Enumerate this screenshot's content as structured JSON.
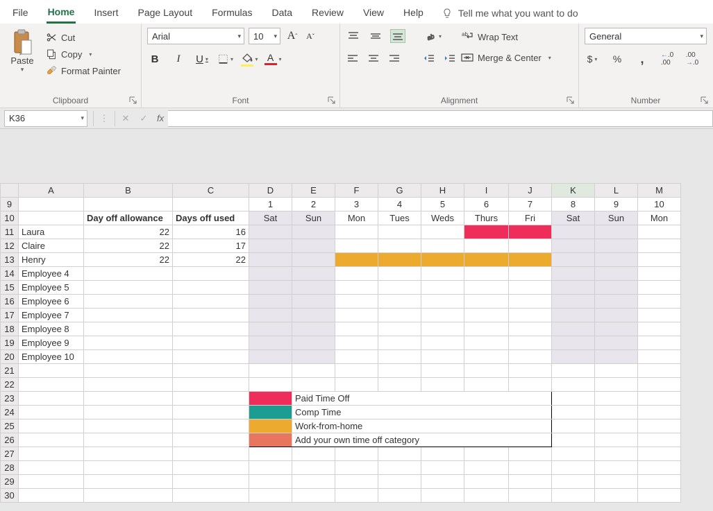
{
  "menu": {
    "items": [
      "File",
      "Home",
      "Insert",
      "Page Layout",
      "Formulas",
      "Data",
      "Review",
      "View",
      "Help"
    ],
    "active": "Home",
    "tellme": "Tell me what you want to do"
  },
  "ribbon": {
    "clipboard": {
      "paste": "Paste",
      "cut": "Cut",
      "copy": "Copy",
      "format_painter": "Format Painter",
      "label": "Clipboard"
    },
    "font": {
      "name": "Arial",
      "size": "10",
      "label": "Font"
    },
    "alignment": {
      "wrap": "Wrap Text",
      "merge": "Merge & Center",
      "label": "Alignment"
    },
    "number": {
      "format": "General",
      "label": "Number"
    }
  },
  "formula_bar": {
    "name_box": "K36",
    "fx": "fx"
  },
  "columns": [
    "A",
    "B",
    "C",
    "D",
    "E",
    "F",
    "G",
    "H",
    "I",
    "J",
    "K",
    "L",
    "M"
  ],
  "rows_visible": [
    9,
    10,
    11,
    12,
    13,
    14,
    15,
    16,
    17,
    18,
    19,
    20,
    21,
    22,
    23,
    24,
    25,
    26,
    27,
    28,
    29,
    30
  ],
  "header_row": {
    "day_nums": [
      "1",
      "2",
      "3",
      "4",
      "5",
      "6",
      "7",
      "8",
      "9",
      "10"
    ],
    "col_b": "Day off allowance",
    "col_c": "Days off used",
    "day_names": [
      "Sat",
      "Sun",
      "Mon",
      "Tues",
      "Weds",
      "Thurs",
      "Fri",
      "Sat",
      "Sun",
      "Mon"
    ]
  },
  "employees": [
    {
      "name": "Laura",
      "allowance": "22",
      "used": "16"
    },
    {
      "name": "Claire",
      "allowance": "22",
      "used": "17"
    },
    {
      "name": "Henry",
      "allowance": "22",
      "used": "22"
    },
    {
      "name": "Employee 4",
      "allowance": "",
      "used": ""
    },
    {
      "name": "Employee 5",
      "allowance": "",
      "used": ""
    },
    {
      "name": "Employee 6",
      "allowance": "",
      "used": ""
    },
    {
      "name": "Employee 7",
      "allowance": "",
      "used": ""
    },
    {
      "name": "Employee 8",
      "allowance": "",
      "used": ""
    },
    {
      "name": "Employee 9",
      "allowance": "",
      "used": ""
    },
    {
      "name": "Employee 10",
      "allowance": "",
      "used": ""
    }
  ],
  "legend": [
    {
      "color": "pto",
      "label": "Paid Time Off"
    },
    {
      "color": "comp",
      "label": "Comp Time"
    },
    {
      "color": "wfh",
      "label": "Work-from-home"
    },
    {
      "color": "own",
      "label": "Add your own time off category"
    }
  ]
}
